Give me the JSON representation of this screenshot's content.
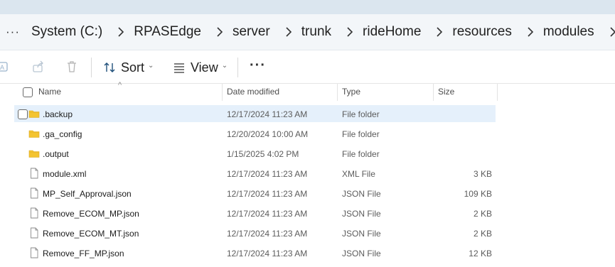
{
  "breadcrumbs": [
    "System (C:)",
    "RPASEdge",
    "server",
    "trunk",
    "rideHome",
    "resources",
    "modules"
  ],
  "toolbar": {
    "sort_label": "Sort",
    "view_label": "View",
    "more_label": "···"
  },
  "columns": {
    "name": "Name",
    "date": "Date modified",
    "type": "Type",
    "size": "Size"
  },
  "files": [
    {
      "name": ".backup",
      "date": "12/17/2024 11:23 AM",
      "type": "File folder",
      "size": "",
      "icon": "folder-icon",
      "selected": true
    },
    {
      "name": ".ga_config",
      "date": "12/20/2024 10:00 AM",
      "type": "File folder",
      "size": "",
      "icon": "folder-icon"
    },
    {
      "name": ".output",
      "date": "1/15/2025 4:02 PM",
      "type": "File folder",
      "size": "",
      "icon": "folder-icon"
    },
    {
      "name": "module.xml",
      "date": "12/17/2024 11:23 AM",
      "type": "XML File",
      "size": "3 KB",
      "icon": "file-icon"
    },
    {
      "name": "MP_Self_Approval.json",
      "date": "12/17/2024 11:23 AM",
      "type": "JSON File",
      "size": "109 KB",
      "icon": "file-icon"
    },
    {
      "name": "Remove_ECOM_MP.json",
      "date": "12/17/2024 11:23 AM",
      "type": "JSON File",
      "size": "2 KB",
      "icon": "file-icon"
    },
    {
      "name": "Remove_ECOM_MT.json",
      "date": "12/17/2024 11:23 AM",
      "type": "JSON File",
      "size": "2 KB",
      "icon": "file-icon"
    },
    {
      "name": "Remove_FF_MP.json",
      "date": "12/17/2024 11:23 AM",
      "type": "JSON File",
      "size": "12 KB",
      "icon": "file-icon"
    }
  ],
  "colors": {
    "selection": "#e5f0fb",
    "folder": "#f4c430",
    "address_bar": "#f3f6f9"
  }
}
